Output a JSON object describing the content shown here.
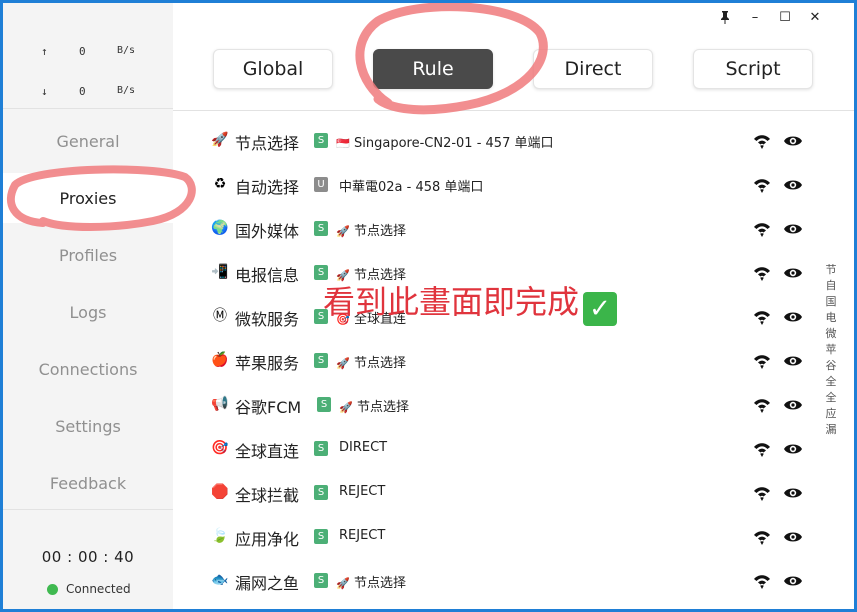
{
  "window": {
    "pin_icon": "pin-icon",
    "minimize_label": "–",
    "maximize_label": "☐",
    "close_label": "✕"
  },
  "traffic": {
    "up_arrow": "↑",
    "up_value": "0",
    "up_unit": "B/s",
    "down_arrow": "↓",
    "down_value": "0",
    "down_unit": "B/s"
  },
  "sidebar": {
    "items": [
      {
        "label": "General"
      },
      {
        "label": "Proxies"
      },
      {
        "label": "Profiles"
      },
      {
        "label": "Logs"
      },
      {
        "label": "Connections"
      },
      {
        "label": "Settings"
      },
      {
        "label": "Feedback"
      }
    ],
    "active_index": 1,
    "timer": "00 : 00 : 40",
    "status": "Connected"
  },
  "modes": [
    {
      "label": "Global"
    },
    {
      "label": "Rule"
    },
    {
      "label": "Direct"
    },
    {
      "label": "Script"
    }
  ],
  "active_mode": 1,
  "groups": [
    {
      "icon": "🚀",
      "name": "节点选择",
      "badge": "S",
      "sel_icon": "🇸🇬",
      "selected": "Singapore-CN2-01 - 457 单端口"
    },
    {
      "icon": "♻",
      "name": "自动选择",
      "badge": "U",
      "sel_icon": "",
      "selected": "中華電02a - 458 单端口"
    },
    {
      "icon": "🌍",
      "name": "国外媒体",
      "badge": "S",
      "sel_icon": "🚀",
      "selected": "节点选择"
    },
    {
      "icon": "📲",
      "name": "电报信息",
      "badge": "S",
      "sel_icon": "🚀",
      "selected": "节点选择"
    },
    {
      "icon": "Ⓜ",
      "name": "微软服务",
      "badge": "S",
      "sel_icon": "🎯",
      "selected": "全球直连"
    },
    {
      "icon": "🍎",
      "name": "苹果服务",
      "badge": "S",
      "sel_icon": "🚀",
      "selected": "节点选择"
    },
    {
      "icon": "📢",
      "name": "谷歌FCM",
      "badge": "S",
      "sel_icon": "🚀",
      "selected": "节点选择"
    },
    {
      "icon": "🎯",
      "name": "全球直连",
      "badge": "S",
      "sel_icon": "",
      "selected": "DIRECT"
    },
    {
      "icon": "🛑",
      "name": "全球拦截",
      "badge": "S",
      "sel_icon": "",
      "selected": "REJECT"
    },
    {
      "icon": "🍃",
      "name": "应用净化",
      "badge": "S",
      "sel_icon": "",
      "selected": "REJECT"
    },
    {
      "icon": "🐟",
      "name": "漏网之鱼",
      "badge": "S",
      "sel_icon": "🚀",
      "selected": "节点选择"
    }
  ],
  "index_letters": [
    "节",
    "自",
    "国",
    "电",
    "微",
    "苹",
    "谷",
    "全",
    "全",
    "应",
    "漏"
  ],
  "annotation": {
    "text": "看到此畫面即完成",
    "check": "✓",
    "color": "#e0343d"
  },
  "colors": {
    "accent_dark": "#4a4a4a",
    "badge_green": "#4caf76",
    "badge_gray": "#8c8c8c",
    "connected": "#3fb950",
    "frame_blue": "#1f7fd6"
  }
}
